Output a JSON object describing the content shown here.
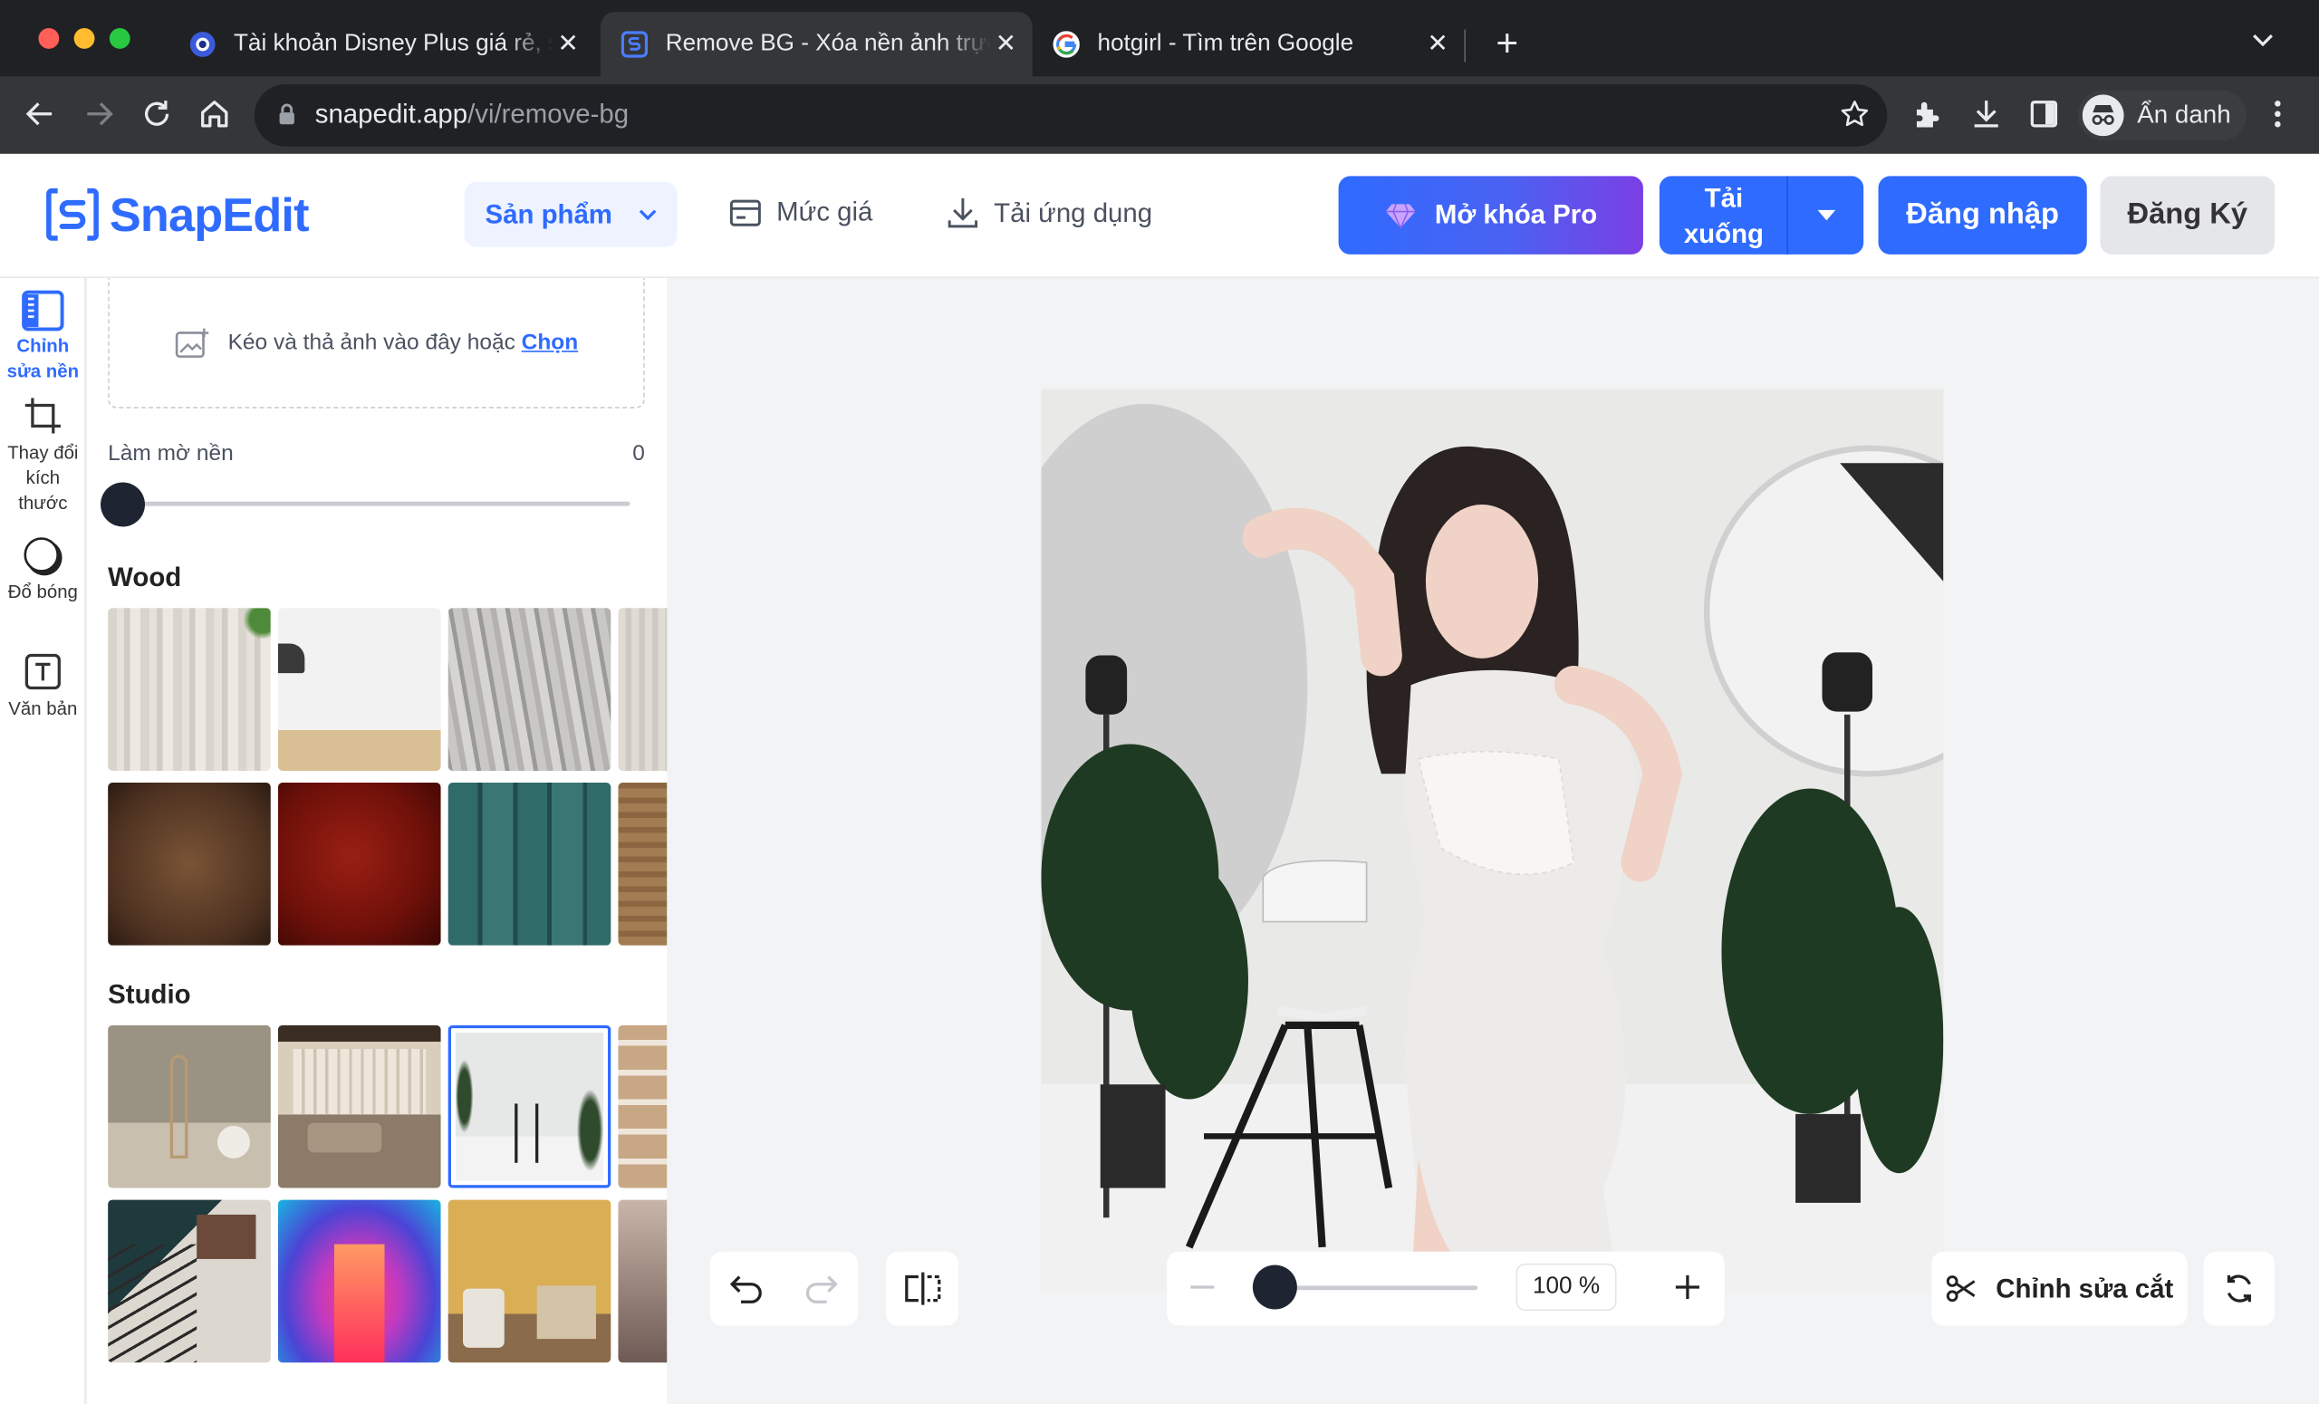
{
  "browser": {
    "tabs": [
      {
        "title": "Tài khoản Disney Plus giá rẻ, s",
        "icon": "disney-icon",
        "active": false
      },
      {
        "title": "Remove BG - Xóa nền ảnh trực",
        "icon": "snapedit-icon",
        "active": true
      },
      {
        "title": "hotgirl - Tìm trên Google",
        "icon": "google-icon",
        "active": false
      }
    ],
    "url_host": "snapedit.app",
    "url_path": "/vi/remove-bg",
    "profile_label": "Ẩn danh"
  },
  "header": {
    "logo_text": "SnapEdit",
    "products_label": "Sản phẩm",
    "pricing_label": "Mức giá",
    "download_app_label": "Tải ứng dụng",
    "unlock_pro_label": "Mở khóa Pro",
    "download_label_line1": "Tải",
    "download_label_line2": "xuống",
    "login_label": "Đăng nhập",
    "signup_label": "Đăng Ký"
  },
  "rail": {
    "items": [
      {
        "line1": "Chỉnh",
        "line2": "sửa nền",
        "icon": "background-edit-icon",
        "active": true
      },
      {
        "line1": "Thay đổi",
        "line2": "kích",
        "line3": "thước",
        "icon": "crop-icon",
        "active": false
      },
      {
        "line1": "Đổ bóng",
        "icon": "shadow-icon",
        "active": false
      },
      {
        "line1": "Văn bản",
        "icon": "text-icon",
        "active": false
      }
    ]
  },
  "panel": {
    "drop_text": "Kéo và thả ảnh vào đây hoặc",
    "drop_link": "Chọn",
    "blur_label": "Làm mờ nền",
    "blur_value": "0",
    "blur_level": 0,
    "sections": [
      {
        "title": "Wood"
      },
      {
        "title": "Studio"
      }
    ],
    "selected_studio_index": 2
  },
  "canvas": {
    "zoom_text": "100 %",
    "zoom_level_fraction": 0.0,
    "edit_cut_label": "Chỉnh sửa cắt"
  },
  "colors": {
    "accent": "#2f6bff",
    "pro_gradient_start": "#2f6bff",
    "pro_gradient_end": "#7b3fe4",
    "tab_bar": "#202124",
    "toolbar": "#35363a"
  }
}
